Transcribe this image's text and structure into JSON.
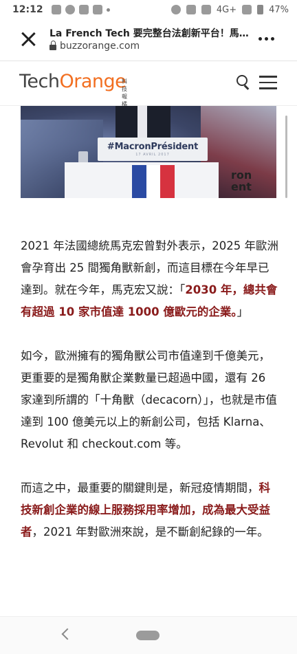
{
  "status_bar": {
    "time": "12:12",
    "network": "4G+",
    "battery": "47%"
  },
  "browser": {
    "page_title": "La French Tech 要完整台法創新平台！馬…",
    "url": "buzzorange.com"
  },
  "site": {
    "logo_tech": "Tech",
    "logo_orange": "Orange",
    "logo_sub": "科技報橘"
  },
  "hero": {
    "podium_hashtag": "#MacronPrésident",
    "podium_date": "17 AVRIL 2017",
    "sign_text_1": "ron",
    "sign_text_2": "ent"
  },
  "article": {
    "p1_a": "2021 年法國總統馬克宏曾對外表示，2025 年歐洲會孕育出 25 間獨角獸新創，而這目標在今年早已達到。就在今年，馬克宏又說：「",
    "p1_hl": "2030 年，總共會有超過 10 家市值達 1000 億歐元的企業。",
    "p1_b": "」",
    "p2": "如今，歐洲擁有的獨角獸公司市值達到千億美元，更重要的是獨角獸企業數量已超過中國，還有 26 家達到所謂的「十角獸（decacorn）」，也就是市值達到 100 億美元以上的新創公司，包括 Klarna、Revolut 和 checkout.com 等。",
    "p3_a": "而這之中，最重要的關鍵則是，新冠疫情期間，",
    "p3_hl": "科技新創企業的線上服務採用率增加，成為最大受益者",
    "p3_b": "，2021 年對歐洲來說，是不斷創紀錄的一年。"
  },
  "colors": {
    "brand_orange": "#f26f21",
    "highlight_red": "#8a1c1c"
  }
}
